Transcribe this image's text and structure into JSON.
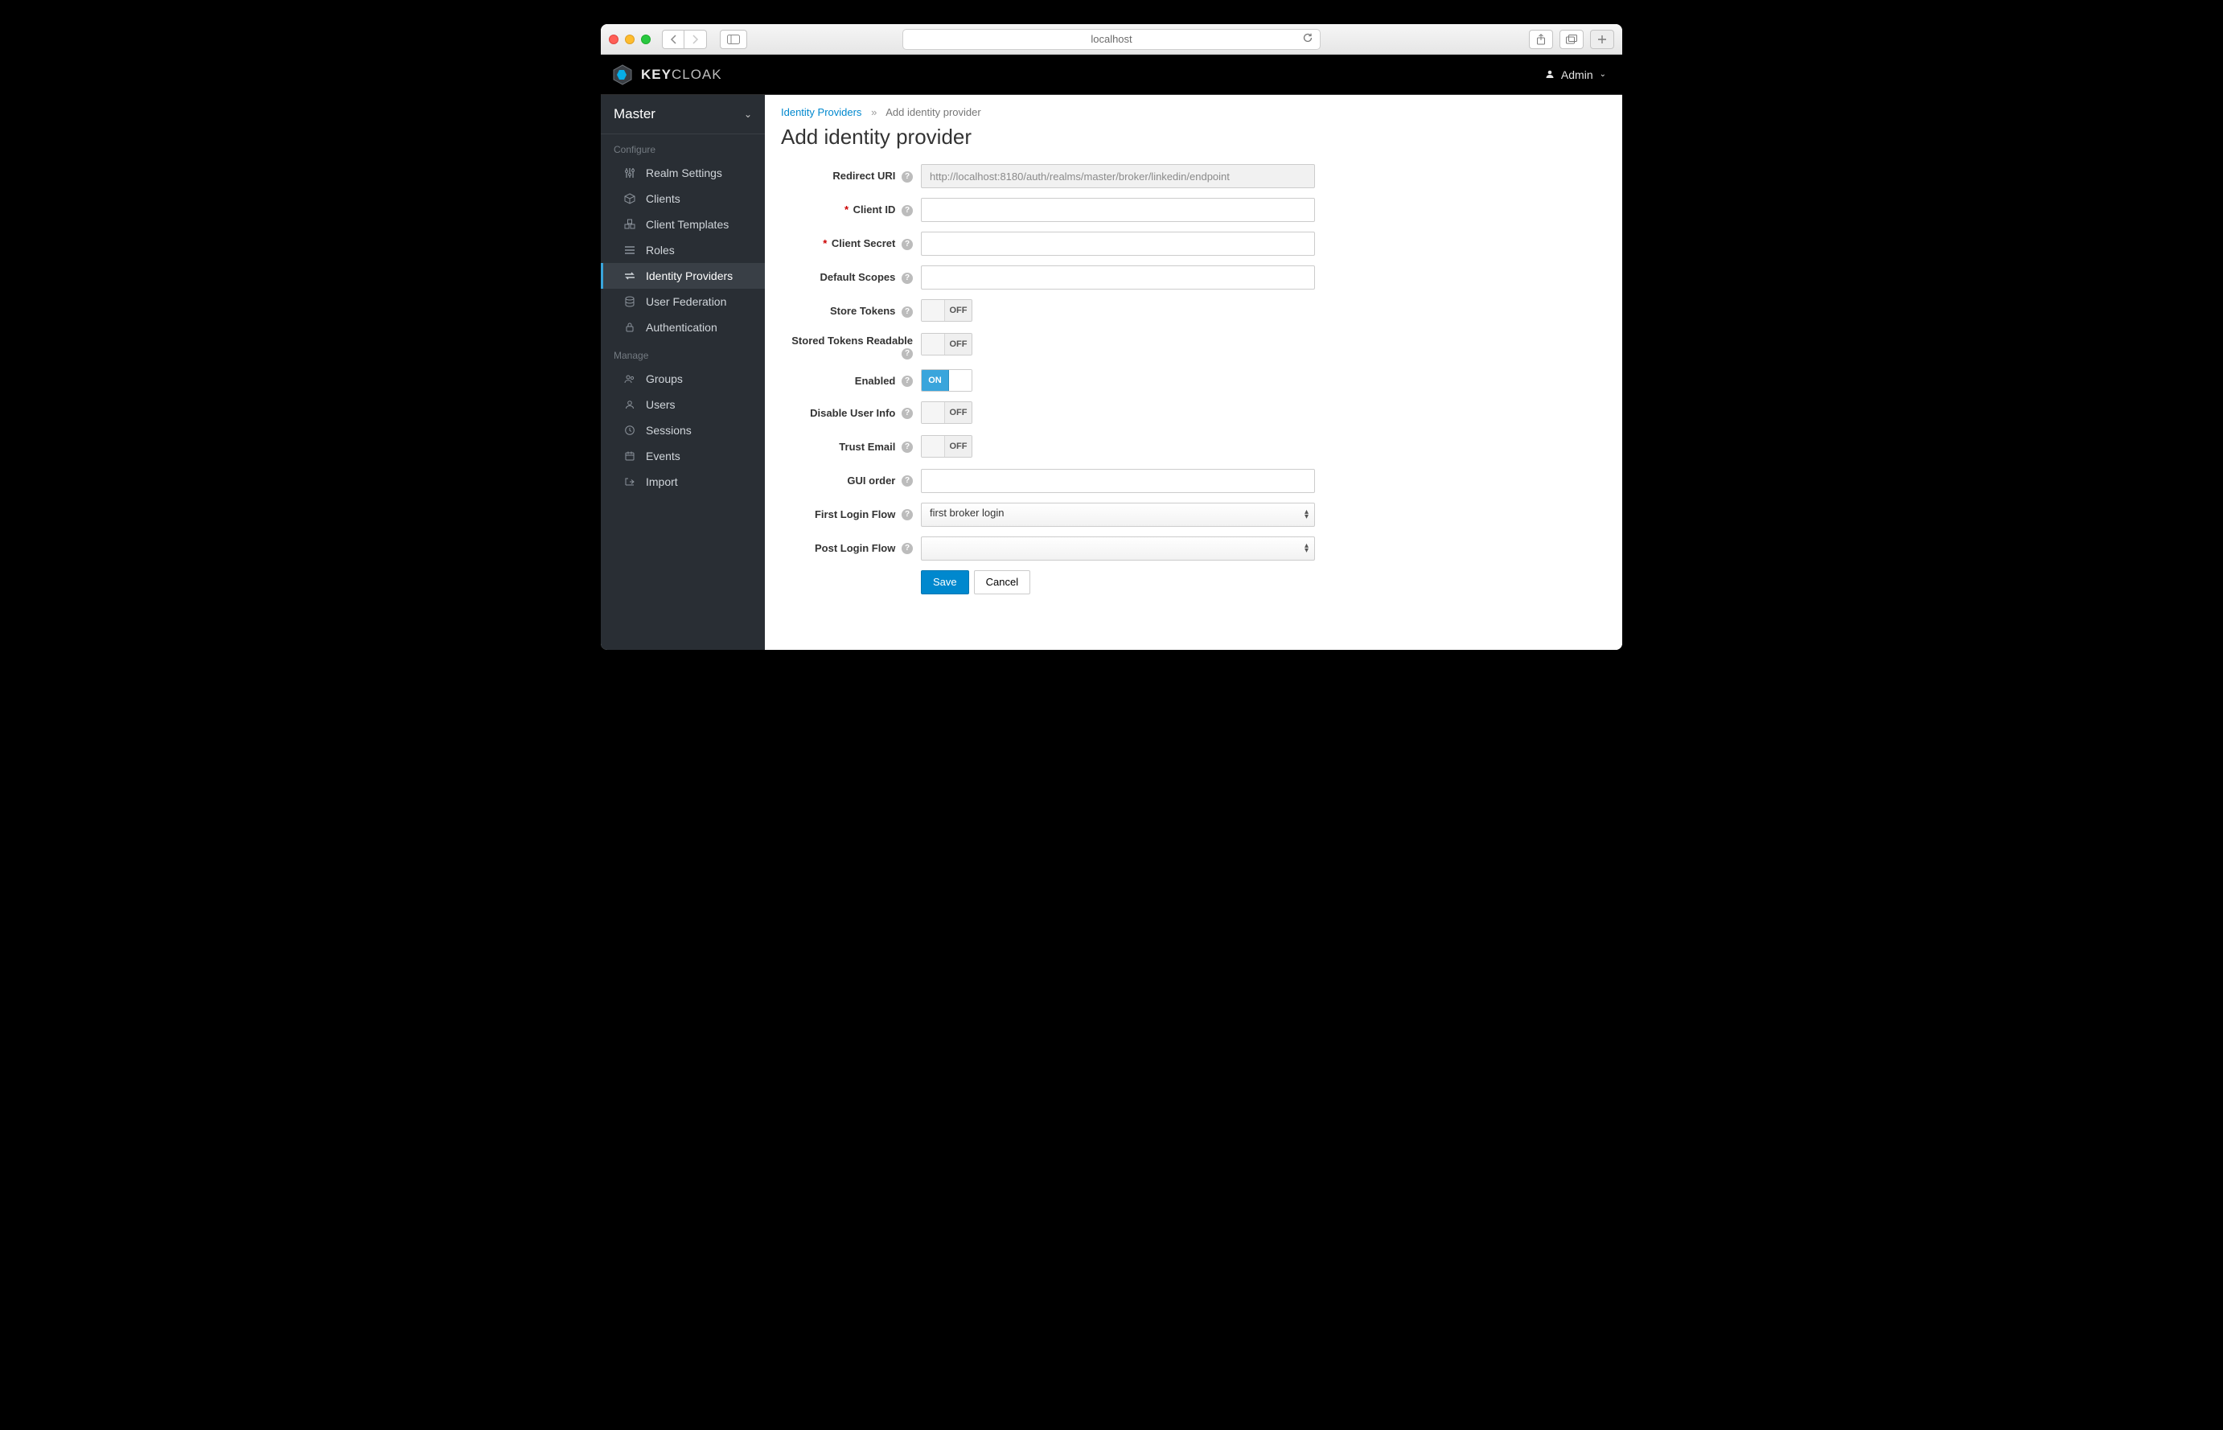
{
  "browser": {
    "address": "localhost"
  },
  "header": {
    "brand_primary": "KEY",
    "brand_secondary": "CLOAK",
    "user": "Admin"
  },
  "sidebar": {
    "realm": "Master",
    "sections": {
      "configure_label": "Configure",
      "manage_label": "Manage"
    },
    "configure": [
      {
        "label": "Realm Settings"
      },
      {
        "label": "Clients"
      },
      {
        "label": "Client Templates"
      },
      {
        "label": "Roles"
      },
      {
        "label": "Identity Providers"
      },
      {
        "label": "User Federation"
      },
      {
        "label": "Authentication"
      }
    ],
    "manage": [
      {
        "label": "Groups"
      },
      {
        "label": "Users"
      },
      {
        "label": "Sessions"
      },
      {
        "label": "Events"
      },
      {
        "label": "Import"
      }
    ]
  },
  "breadcrumb": {
    "link": "Identity Providers",
    "current": "Add identity provider"
  },
  "page": {
    "title": "Add identity provider"
  },
  "form": {
    "redirect_uri": {
      "label": "Redirect URI",
      "value": "http://localhost:8180/auth/realms/master/broker/linkedin/endpoint"
    },
    "client_id": {
      "label": "Client ID",
      "value": ""
    },
    "client_secret": {
      "label": "Client Secret",
      "value": ""
    },
    "default_scopes": {
      "label": "Default Scopes",
      "value": ""
    },
    "store_tokens": {
      "label": "Store Tokens",
      "state": "OFF"
    },
    "stored_tokens_readable": {
      "label": "Stored Tokens Readable",
      "state": "OFF"
    },
    "enabled": {
      "label": "Enabled",
      "state": "ON"
    },
    "disable_user_info": {
      "label": "Disable User Info",
      "state": "OFF"
    },
    "trust_email": {
      "label": "Trust Email",
      "state": "OFF"
    },
    "gui_order": {
      "label": "GUI order",
      "value": ""
    },
    "first_login_flow": {
      "label": "First Login Flow",
      "value": "first broker login"
    },
    "post_login_flow": {
      "label": "Post Login Flow",
      "value": ""
    },
    "buttons": {
      "save": "Save",
      "cancel": "Cancel"
    }
  }
}
